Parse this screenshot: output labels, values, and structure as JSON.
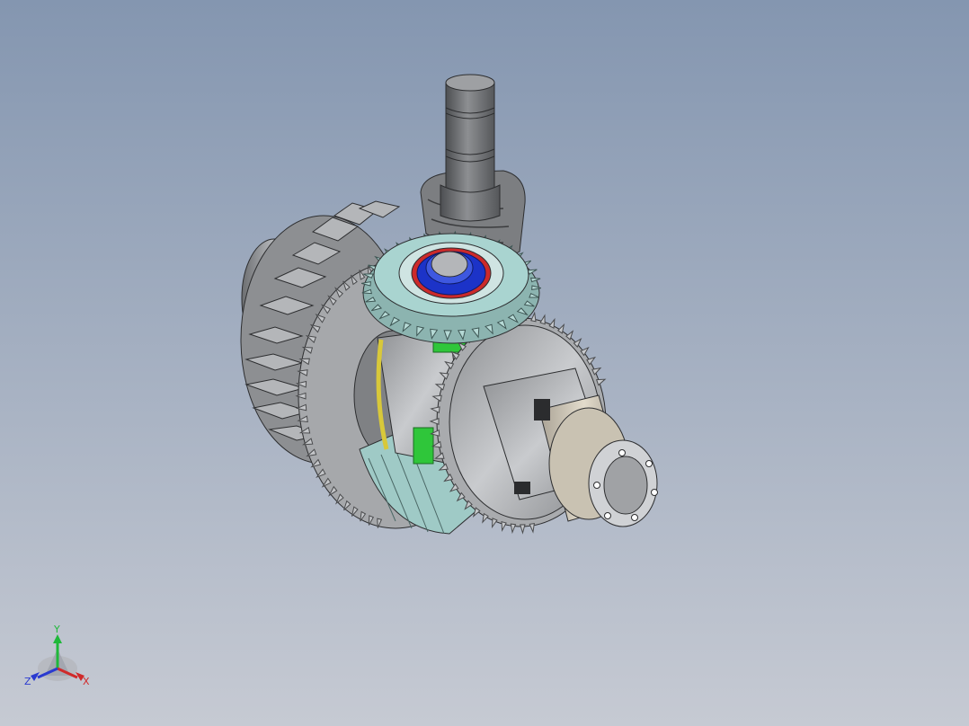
{
  "viewport": {
    "background_top": "#8496b0",
    "background_bottom": "#c6cad3"
  },
  "model": {
    "part_colors": {
      "steel": "#9a9c9f",
      "steel_dark": "#5b5d60",
      "bevel_pinion": "#a9d4d0",
      "bearing_inner": "#1c33c8",
      "seal_ring": "#cc2a2a",
      "spider_gear": "#2fc63a",
      "washer": "#d8c83a",
      "hub": "#c8bfae"
    }
  },
  "triad": {
    "x_label": "X",
    "y_label": "Y",
    "z_label": "Z",
    "x_color": "#d02a2a",
    "y_color": "#1fb83a",
    "z_color": "#2a3ad0"
  }
}
